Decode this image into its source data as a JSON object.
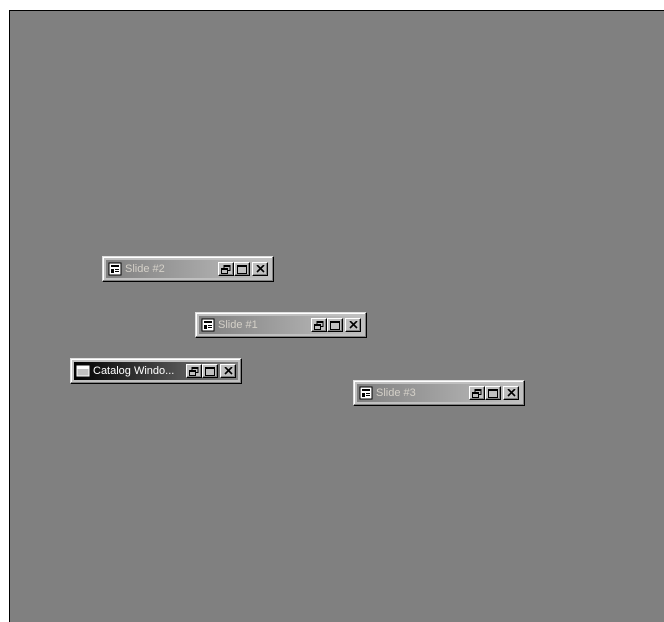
{
  "desktop": {
    "background": "#808080"
  },
  "windows": [
    {
      "key": "slide2",
      "title": "Slide #2",
      "state": "inactive",
      "icon": "slide-document-icon"
    },
    {
      "key": "slide1",
      "title": "Slide #1",
      "state": "inactive",
      "icon": "slide-document-icon"
    },
    {
      "key": "catalog",
      "title": "Catalog Windo...",
      "state": "active",
      "icon": "catalog-window-icon"
    },
    {
      "key": "slide3",
      "title": "Slide #3",
      "state": "inactive",
      "icon": "slide-document-icon"
    }
  ],
  "controls": {
    "restore": "restore-icon",
    "maximize": "maximize-icon",
    "close": "close-icon"
  },
  "colors": {
    "active_title": "#000000",
    "inactive_title": "#808080",
    "button_face": "#c0c0c0"
  }
}
